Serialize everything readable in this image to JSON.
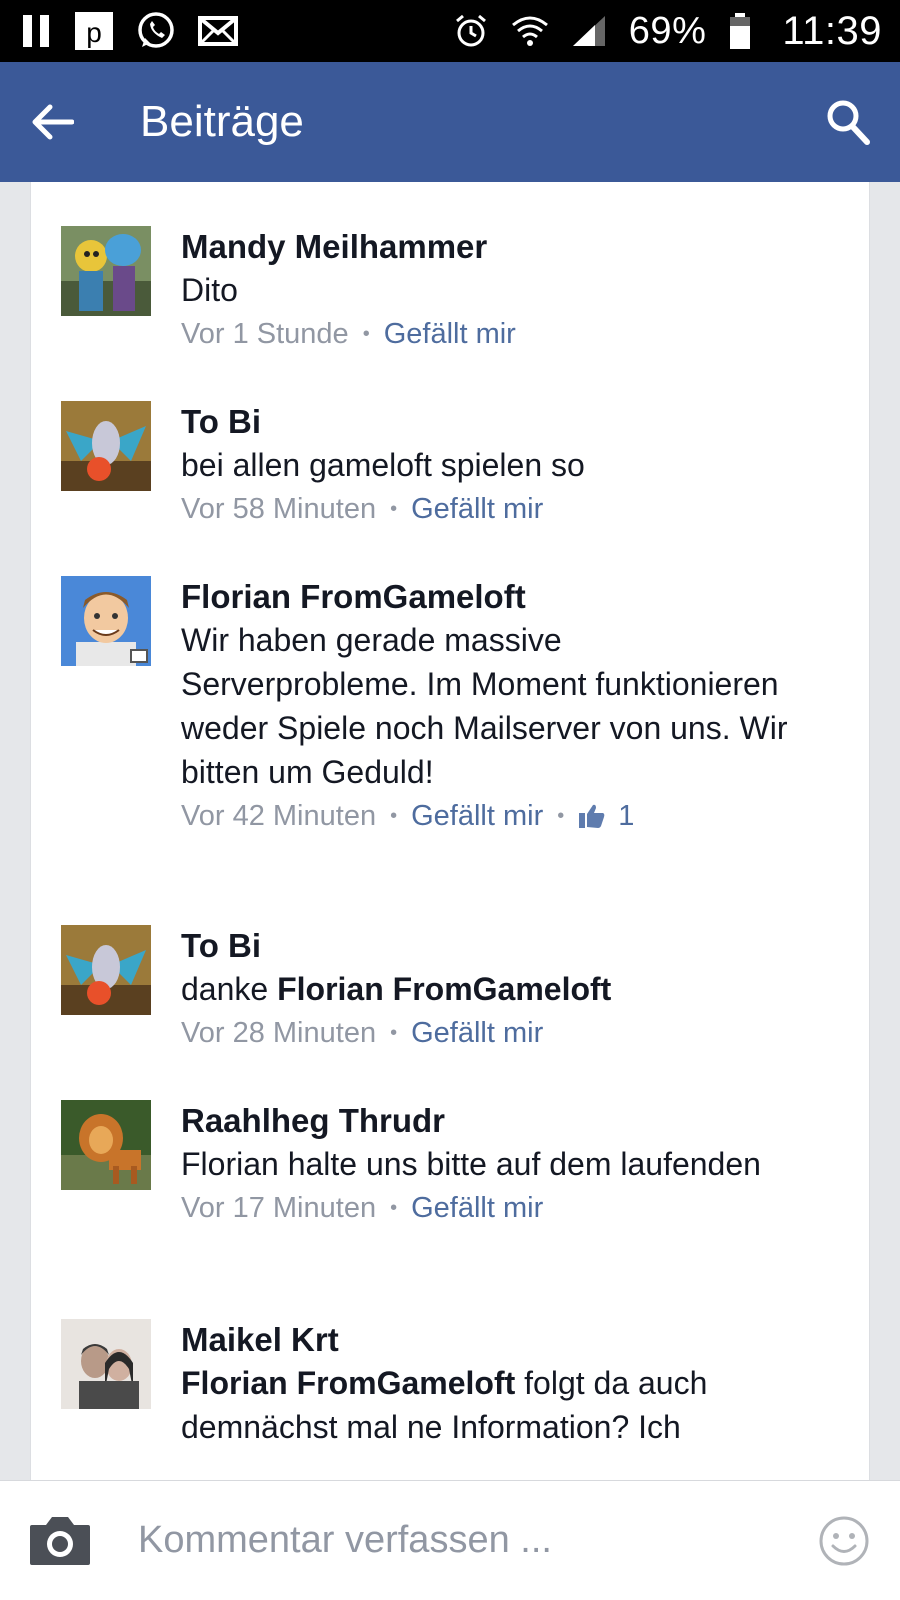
{
  "status_bar": {
    "battery": "69%",
    "time": "11:39",
    "icons": [
      "pause-icon",
      "app-p-icon",
      "whatsapp-icon",
      "mail-icon",
      "alarm-icon",
      "wifi-icon",
      "signal-icon",
      "battery-icon"
    ]
  },
  "app_bar": {
    "title": "Beiträge",
    "back_icon": "back-arrow-icon",
    "search_icon": "search-icon",
    "color": "#3b5998"
  },
  "comments": [
    {
      "author": "Mandy Meilhammer",
      "text": "Dito",
      "time": "Vor 1 Stunde",
      "like": "Gefällt mir"
    },
    {
      "author": "To Bi",
      "text": "bei allen gameloft spielen so",
      "time": "Vor 58 Minuten",
      "like": "Gefällt mir"
    },
    {
      "author": "Florian FromGameloft",
      "text": "Wir haben gerade massive Serverprobleme. Im Moment funktionieren weder Spiele noch Mailserver von uns. Wir bitten um Geduld!",
      "time": "Vor 42 Minuten",
      "like": "Gefällt mir",
      "like_count": "1"
    },
    {
      "author": "To Bi",
      "text_prefix": "danke ",
      "mention": "Florian FromGameloft",
      "time": "Vor 28 Minuten",
      "like": "Gefällt mir"
    },
    {
      "author": "Raahlheg Thrudr",
      "text": "Florian halte uns bitte auf dem laufenden",
      "time": "Vor 17 Minuten",
      "like": "Gefällt mir"
    },
    {
      "author": "Maikel Krt",
      "mention": "Florian FromGameloft",
      "text_suffix": " folgt da auch demnächst mal ne Information? Ich"
    }
  ],
  "composer": {
    "placeholder": "Kommentar verfassen ...",
    "camera_icon": "camera-icon",
    "emoji_icon": "smiley-icon"
  }
}
